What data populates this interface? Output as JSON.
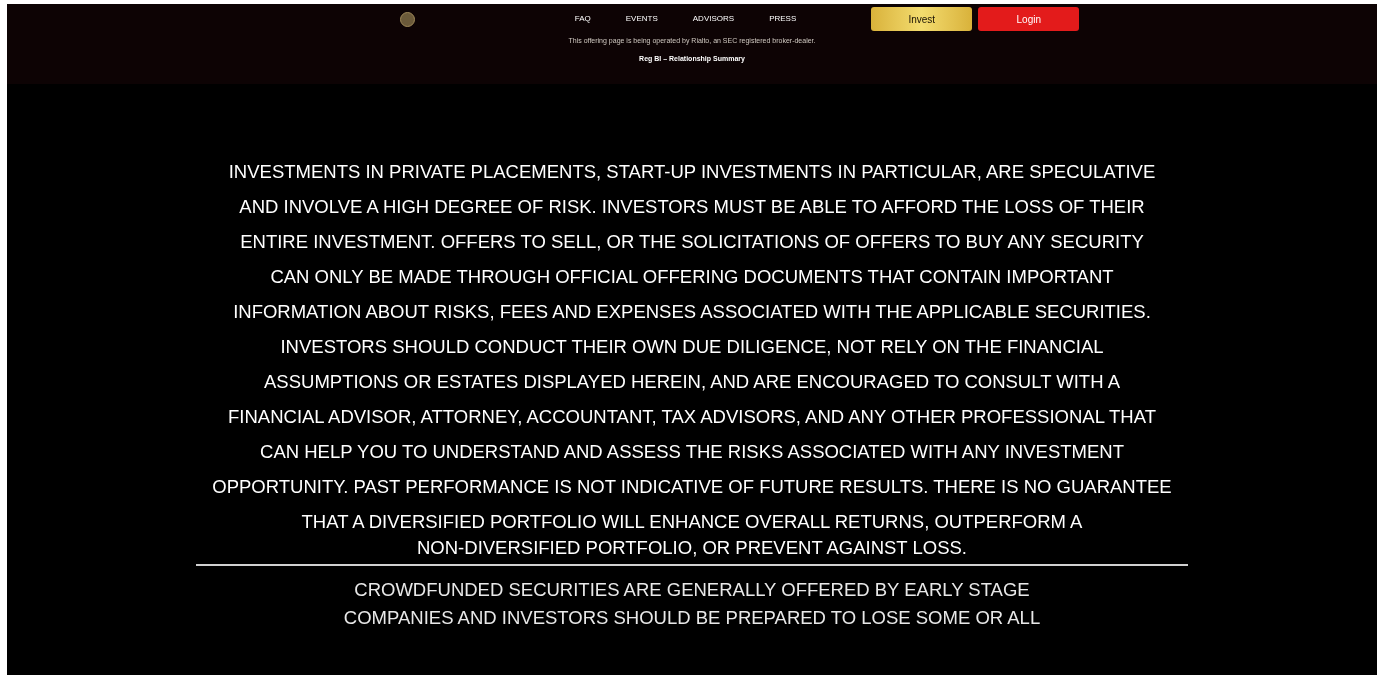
{
  "nav": {
    "links": [
      "FAQ",
      "EVENTS",
      "ADVISORS",
      "PRESS"
    ],
    "buttons": [
      {
        "label": "Invest",
        "kind": "gold"
      },
      {
        "label": "Login",
        "kind": "red"
      }
    ],
    "notice": "This offering page is being operated by Rialto, an SEC registered broker-dealer.",
    "summary_link": "Reg BI – Relationship Summary"
  },
  "disclaimer": {
    "lines": [
      "INVESTMENTS IN PRIVATE PLACEMENTS, START-UP INVESTMENTS IN PARTICULAR, ARE SPECULATIVE",
      "AND INVOLVE A HIGH DEGREE OF RISK. INVESTORS MUST BE ABLE TO AFFORD THE LOSS OF THEIR",
      "ENTIRE INVESTMENT. OFFERS TO SELL, OR THE SOLICITATIONS OF OFFERS TO BUY ANY SECURITY",
      "CAN ONLY BE MADE THROUGH OFFICIAL OFFERING DOCUMENTS THAT CONTAIN IMPORTANT",
      "INFORMATION ABOUT RISKS, FEES AND EXPENSES ASSOCIATED WITH THE APPLICABLE SECURITIES.",
      "INVESTORS SHOULD CONDUCT THEIR OWN DUE DILIGENCE, NOT RELY ON THE FINANCIAL",
      "ASSUMPTIONS OR ESTATES DISPLAYED HEREIN, AND ARE ENCOURAGED TO CONSULT WITH A",
      "FINANCIAL ADVISOR, ATTORNEY, ACCOUNTANT, TAX ADVISORS, AND ANY OTHER PROFESSIONAL THAT",
      "CAN HELP YOU TO UNDERSTAND AND ASSESS THE RISKS ASSOCIATED WITH ANY INVESTMENT",
      "OPPORTUNITY. PAST PERFORMANCE IS NOT INDICATIVE OF FUTURE RESULTS. THERE IS NO GUARANTEE",
      "THAT A DIVERSIFIED PORTFOLIO WILL ENHANCE OVERALL RETURNS, OUTPERFORM A",
      "NON-DIVERSIFIED PORTFOLIO, OR PREVENT AGAINST LOSS."
    ],
    "crowdfunding_lines": [
      "CROWDFUNDED SECURITIES ARE GENERALLY OFFERED BY EARLY STAGE",
      "COMPANIES AND INVESTORS SHOULD BE PREPARED TO LOSE SOME OR ALL"
    ]
  }
}
